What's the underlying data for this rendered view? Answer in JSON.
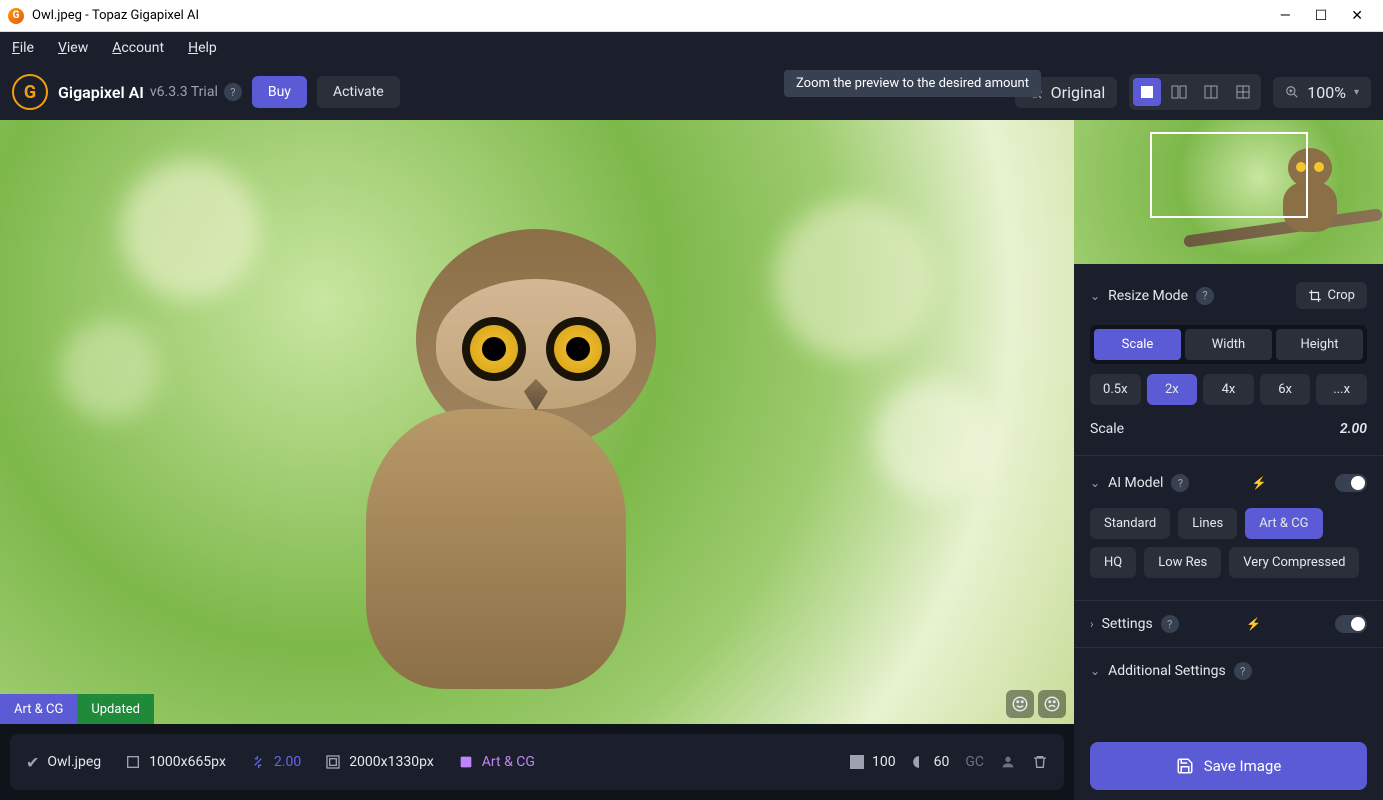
{
  "titlebar": {
    "filename": "Owl.jpeg",
    "appname": "Topaz Gigapixel AI"
  },
  "menu": {
    "file": "File",
    "view": "View",
    "account": "Account",
    "help": "Help"
  },
  "top": {
    "app": "Gigapixel AI",
    "version": "v6.3.3 Trial",
    "buy": "Buy",
    "activate": "Activate",
    "original": "Original",
    "zoom": "100%",
    "tooltip": "Zoom the preview to the desired amount"
  },
  "status": {
    "model": "Art & CG",
    "state": "Updated"
  },
  "resize": {
    "title": "Resize Mode",
    "crop": "Crop",
    "modes": {
      "scale": "Scale",
      "width": "Width",
      "height": "Height"
    },
    "factors": {
      "f05": "0.5x",
      "f2": "2x",
      "f4": "4x",
      "f6": "6x",
      "custom": "...x"
    },
    "scale_label": "Scale",
    "scale_value": "2.00"
  },
  "ai": {
    "title": "AI Model",
    "models": {
      "standard": "Standard",
      "lines": "Lines",
      "artcg": "Art & CG",
      "hq": "HQ",
      "lowres": "Low Res",
      "vcomp": "Very Compressed"
    }
  },
  "settings": {
    "title": "Settings"
  },
  "additional": {
    "title": "Additional Settings"
  },
  "bottom": {
    "filename": "Owl.jpeg",
    "original_size": "1000x665px",
    "scale": "2.00",
    "output_size": "2000x1330px",
    "model": "Art & CG",
    "quality": "100",
    "dpi": "60",
    "gc": "GC"
  },
  "save": {
    "label": "Save Image"
  }
}
